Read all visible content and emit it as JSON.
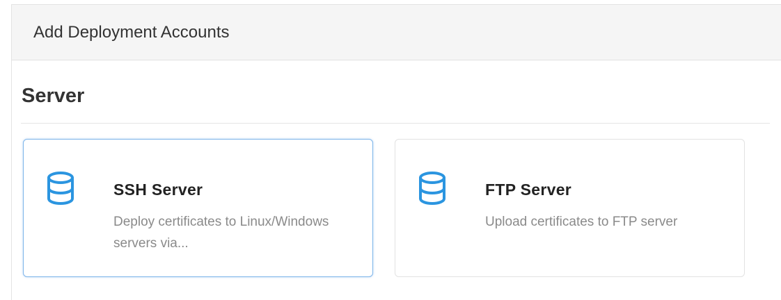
{
  "header": {
    "title": "Add Deployment Accounts"
  },
  "section": {
    "title": "Server"
  },
  "cards": [
    {
      "title": "SSH Server",
      "description": "Deploy certificates to Linux/Windows servers via...",
      "icon": "database-icon",
      "selected": true
    },
    {
      "title": "FTP Server",
      "description": "Upload certificates to FTP server",
      "icon": "database-icon",
      "selected": false
    }
  ],
  "colors": {
    "icon": "#2b95e0",
    "selected_border": "#7fb6ea",
    "header_bg": "#f5f5f5",
    "description": "#8a8a8a"
  }
}
